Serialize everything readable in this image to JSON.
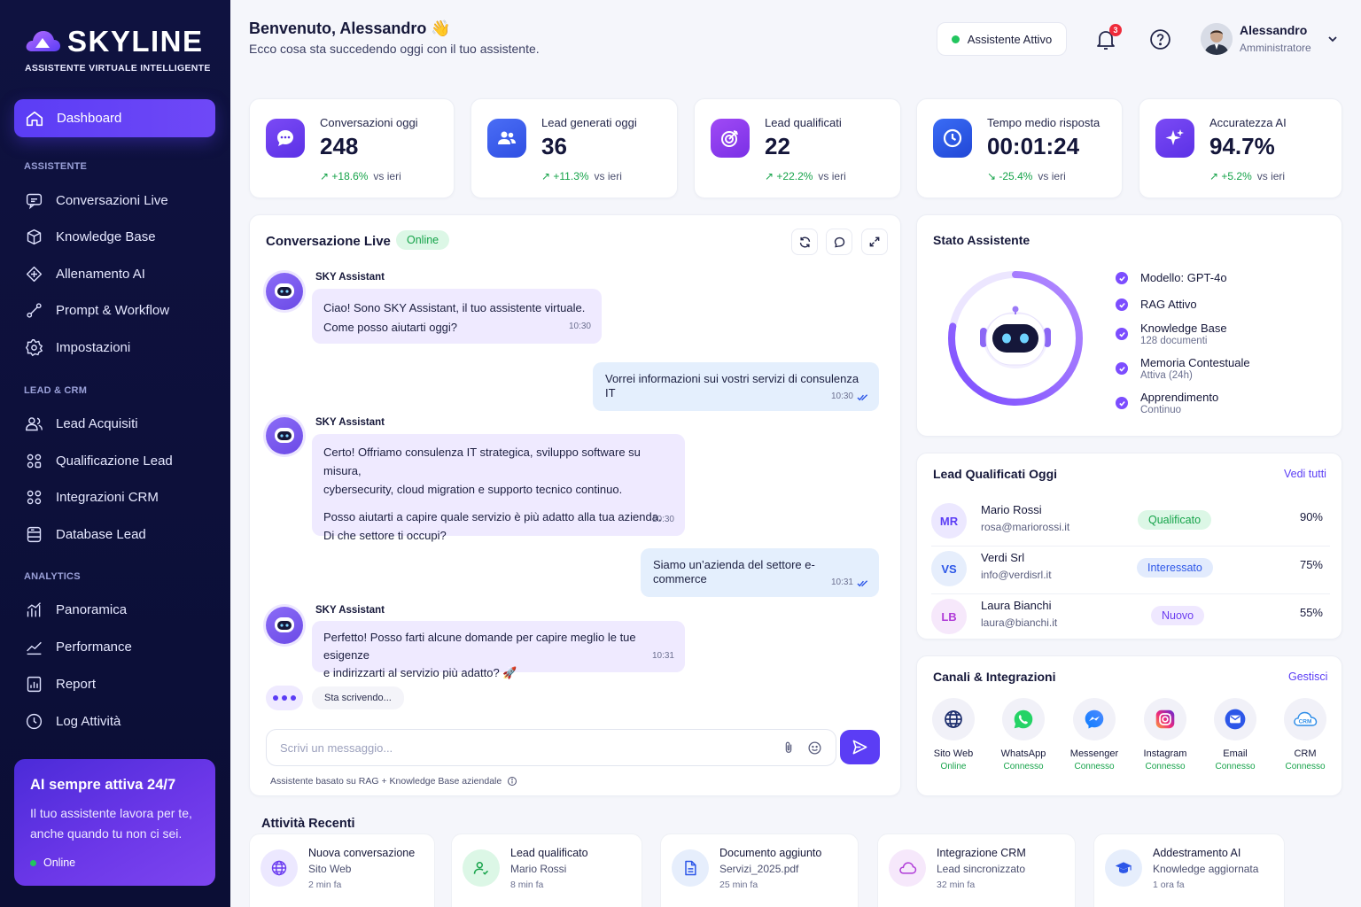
{
  "brand": {
    "name": "SKYLINE",
    "tagline": "ASSISTENTE VIRTUALE INTELLIGENTE"
  },
  "sidebar": {
    "active": "Dashboard",
    "sections": [
      {
        "title": "ASSISTENTE",
        "items": [
          "Conversazioni Live",
          "Knowledge Base",
          "Allenamento AI",
          "Prompt & Workflow",
          "Impostazioni"
        ]
      },
      {
        "title": "LEAD & CRM",
        "items": [
          "Lead Acquisiti",
          "Qualificazione Lead",
          "Integrazioni CRM",
          "Database Lead"
        ]
      },
      {
        "title": "ANALYTICS",
        "items": [
          "Panoramica",
          "Performance",
          "Report",
          "Log Attività"
        ]
      }
    ],
    "promo": {
      "title": "AI sempre attiva 24/7",
      "text": "Il tuo assistente lavora per te, anche quando tu non ci sei.",
      "status": "Online"
    }
  },
  "header": {
    "greeting": "Benvenuto, Alessandro 👋",
    "subtitle": "Ecco cosa sta succedendo oggi con il tuo assistente.",
    "assistant_status": "Assistente Attivo",
    "notifications": "3",
    "user": {
      "name": "Alessandro",
      "role": "Amministratore"
    }
  },
  "stats": [
    {
      "label": "Conversazioni oggi",
      "value": "248",
      "trend": "↗ +18.6%",
      "compare": "vs ieri",
      "icon": "chat-icon",
      "color": "#6c3cf0"
    },
    {
      "label": "Lead generati oggi",
      "value": "36",
      "trend": "↗ +11.3%",
      "compare": "vs ieri",
      "icon": "users-icon",
      "color": "#3a5cf0"
    },
    {
      "label": "Lead qualificati",
      "value": "22",
      "trend": "↗ +22.2%",
      "compare": "vs ieri",
      "icon": "target-icon",
      "color": "#8b3cf0"
    },
    {
      "label": "Tempo medio risposta",
      "value": "00:01:24",
      "trend": "↘ -25.4%",
      "compare": "vs ieri",
      "icon": "clock-icon",
      "color": "#2d57e8"
    },
    {
      "label": "Accuratezza AI",
      "value": "94.7%",
      "trend": "↗ +5.2%",
      "compare": "vs ieri",
      "icon": "sparkle-icon",
      "color": "#6c3cf0"
    }
  ],
  "chat": {
    "title": "Conversazione Live",
    "status": "Online",
    "bot_name": "SKY Assistant",
    "messages": [
      {
        "from": "bot",
        "lines": [
          "Ciao! Sono SKY Assistant, il tuo assistente virtuale.",
          "Come posso aiutarti oggi?"
        ],
        "time": "10:30"
      },
      {
        "from": "user",
        "text": "Vorrei informazioni sui vostri servizi di consulenza IT",
        "time": "10:30"
      },
      {
        "from": "bot",
        "lines": [
          "Certo! Offriamo consulenza IT strategica, sviluppo software su misura,",
          "cybersecurity, cloud migration e supporto tecnico continuo.",
          "Posso aiutarti a capire quale servizio è più adatto alla tua azienda.",
          "Di che settore ti occupi?"
        ],
        "time": "10:30"
      },
      {
        "from": "user",
        "text": "Siamo un’azienda del settore e-commerce",
        "time": "10:31"
      },
      {
        "from": "bot",
        "lines": [
          "Perfetto! Posso farti alcune domande per capire meglio le tue esigenze",
          "e indirizzarti al servizio più adatto? 🚀"
        ],
        "time": "10:31"
      }
    ],
    "typing": "Sta scrivendo...",
    "placeholder": "Scrivi un messaggio...",
    "footnote": "Assistente basato su RAG + Knowledge Base aziendale"
  },
  "assistant_state": {
    "title": "Stato Assistente",
    "progress": 0.78,
    "items": [
      {
        "title": "Modello: GPT-4o",
        "sub": ""
      },
      {
        "title": "RAG Attivo",
        "sub": ""
      },
      {
        "title": "Knowledge Base",
        "sub": "128 documenti"
      },
      {
        "title": "Memoria Contestuale",
        "sub": "Attiva (24h)"
      },
      {
        "title": "Apprendimento",
        "sub": "Continuo"
      }
    ]
  },
  "leads": {
    "title": "Lead Qualificati Oggi",
    "link": "Vedi tutti",
    "rows": [
      {
        "initials": "MR",
        "name": "Mario Rossi",
        "email": "rosa@mariorossi.it",
        "status": "Qualificato",
        "score": "90%",
        "status_color": "#16a34a",
        "status_bg": "#dcf7e6",
        "av_color": "#5b3df5",
        "av_bg": "#ece8ff"
      },
      {
        "initials": "VS",
        "name": "Verdi Srl",
        "email": "info@verdisrl.it",
        "status": "Interessato",
        "score": "75%",
        "status_color": "#2d57e8",
        "status_bg": "#e2ebfd",
        "av_color": "#2d57e8",
        "av_bg": "#e6eefc"
      },
      {
        "initials": "LB",
        "name": "Laura Bianchi",
        "email": "laura@bianchi.it",
        "status": "Nuovo",
        "score": "55%",
        "status_color": "#6b3cf0",
        "status_bg": "#efe8ff",
        "av_color": "#b03cd8",
        "av_bg": "#f6e8fb"
      }
    ]
  },
  "channels": {
    "title": "Canali & Integrazioni",
    "link": "Gestisci",
    "items": [
      {
        "name": "Sito Web",
        "status": "Online",
        "icon": "globe-icon"
      },
      {
        "name": "WhatsApp",
        "status": "Connesso",
        "icon": "whatsapp-icon"
      },
      {
        "name": "Messenger",
        "status": "Connesso",
        "icon": "messenger-icon"
      },
      {
        "name": "Instagram",
        "status": "Connesso",
        "icon": "instagram-icon"
      },
      {
        "name": "Email",
        "status": "Connesso",
        "icon": "email-icon"
      },
      {
        "name": "CRM",
        "status": "Connesso",
        "icon": "crm-icon"
      }
    ]
  },
  "activities": {
    "title": "Attività Recenti",
    "items": [
      {
        "title": "Nuova conversazione",
        "sub": "Sito Web",
        "time": "2 min fa",
        "icon": "globe-icon"
      },
      {
        "title": "Lead qualificato",
        "sub": "Mario Rossi",
        "time": "8 min fa",
        "icon": "user-check-icon"
      },
      {
        "title": "Documento aggiunto",
        "sub": "Servizi_2025.pdf",
        "time": "25 min fa",
        "icon": "document-icon"
      },
      {
        "title": "Integrazione CRM",
        "sub": "Lead sincronizzato",
        "time": "32 min fa",
        "icon": "cloud-icon"
      },
      {
        "title": "Addestramento AI",
        "sub": "Knowledge aggiornata",
        "time": "1 ora fa",
        "icon": "graduation-icon"
      }
    ]
  }
}
